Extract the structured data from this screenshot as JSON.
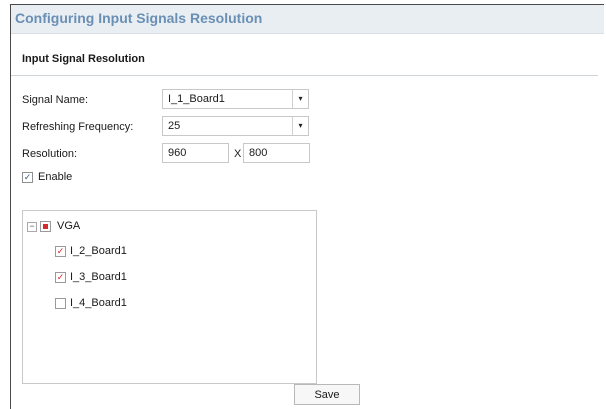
{
  "panel": {
    "title": "Configuring Input Signals Resolution"
  },
  "section": {
    "title": "Input Signal Resolution"
  },
  "form": {
    "signal_name": {
      "label": "Signal Name:",
      "value": "I_1_Board1"
    },
    "refresh": {
      "label": "Refreshing Frequency:",
      "value": "25"
    },
    "resolution": {
      "label": "Resolution:",
      "width": "960",
      "separator": "X",
      "height": "800"
    },
    "enable": {
      "label": "Enable",
      "checked": true
    },
    "dropdown_glyph": "▾",
    "check_glyph": "✓",
    "collapse_glyph": "−"
  },
  "tree": {
    "root": {
      "label": "VGA",
      "state": "partial"
    },
    "items": [
      {
        "label": "I_2_Board1",
        "checked": true
      },
      {
        "label": "I_3_Board1",
        "checked": true
      },
      {
        "label": "I_4_Board1",
        "checked": false
      }
    ]
  },
  "footer": {
    "save_label": "Save"
  },
  "colors": {
    "title": "#6a8fb5",
    "title_bg": "#e9eef3",
    "check_red": "#d22222"
  }
}
